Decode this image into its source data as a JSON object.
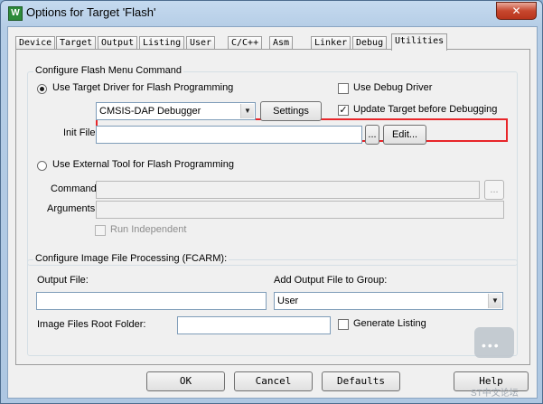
{
  "window": {
    "title": "Options for Target 'Flash'",
    "icon_letter": "W",
    "close_glyph": "✕"
  },
  "tabs": [
    {
      "label": "Device"
    },
    {
      "label": "Target"
    },
    {
      "label": "Output"
    },
    {
      "label": "Listing"
    },
    {
      "label": "User"
    },
    {
      "label": "C/C++"
    },
    {
      "label": "Asm"
    },
    {
      "label": "Linker"
    },
    {
      "label": "Debug"
    },
    {
      "label": "Utilities",
      "active": true
    }
  ],
  "flash_menu": {
    "legend": "Configure Flash Menu Command",
    "use_target_driver_label": "Use Target Driver for Flash Programming",
    "use_target_driver_selected": true,
    "use_debug_driver_label": "Use Debug Driver",
    "use_debug_driver_checked": false,
    "driver_select_value": "CMSIS-DAP Debugger",
    "settings_label": "Settings",
    "update_target_label": "Update Target before Debugging",
    "update_target_checked": true,
    "init_file_label": "Init File:",
    "init_file_value": "",
    "browse_label": "...",
    "edit_label": "Edit...",
    "use_external_tool_label": "Use External Tool for Flash Programming",
    "use_external_tool_selected": false,
    "command_label": "Command:",
    "command_value": "",
    "command_browse_label": "...",
    "arguments_label": "Arguments:",
    "arguments_value": "",
    "run_independent_label": "Run Independent",
    "run_independent_checked": false
  },
  "image_processing": {
    "legend": "Configure Image File Processing (FCARM):",
    "output_file_label": "Output File:",
    "output_file_value": "",
    "add_to_group_label": "Add Output File  to Group:",
    "group_value": "User",
    "root_folder_label": "Image Files Root Folder:",
    "root_folder_value": "",
    "generate_listing_label": "Generate Listing",
    "generate_listing_checked": false
  },
  "footer": {
    "ok_label": "OK",
    "cancel_label": "Cancel",
    "defaults_label": "Defaults",
    "help_label": "Help"
  },
  "watermark": {
    "text": "ST中文论坛"
  },
  "colors": {
    "highlight_border": "#e8262a",
    "title_bar": "#b5cde6",
    "close_button": "#c7472e"
  }
}
